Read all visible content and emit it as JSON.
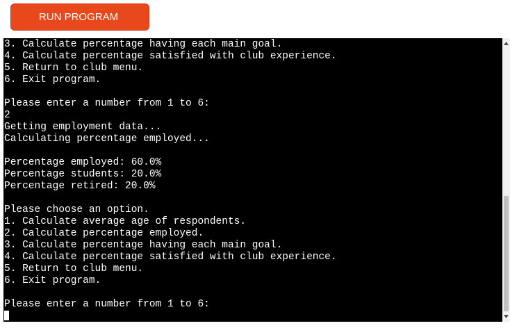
{
  "toolbar": {
    "run_label": "RUN PROGRAM",
    "run_color": "#e8481c"
  },
  "terminal": {
    "background": "#000000",
    "text_color": "#ffffff",
    "lines": [
      "3. Calculate percentage having each main goal.",
      "4. Calculate percentage satisfied with club experience.",
      "5. Return to club menu.",
      "6. Exit program.",
      "",
      "Please enter a number from 1 to 6:",
      "2",
      "Getting employment data...",
      "Calculating percentage employed...",
      "",
      "Percentage employed: 60.0%",
      "Percentage students: 20.0%",
      "Percentage retired: 20.0%",
      "",
      "Please choose an option.",
      "1. Calculate average age of respondents.",
      "2. Calculate percentage employed.",
      "3. Calculate percentage having each main goal.",
      "4. Calculate percentage satisfied with club experience.",
      "5. Return to club menu.",
      "6. Exit program.",
      "",
      "Please enter a number from 1 to 6:"
    ],
    "has_cursor": true
  },
  "scrollbar": {
    "up_icon": "triangle-up-icon",
    "down_icon": "triangle-down-icon"
  }
}
